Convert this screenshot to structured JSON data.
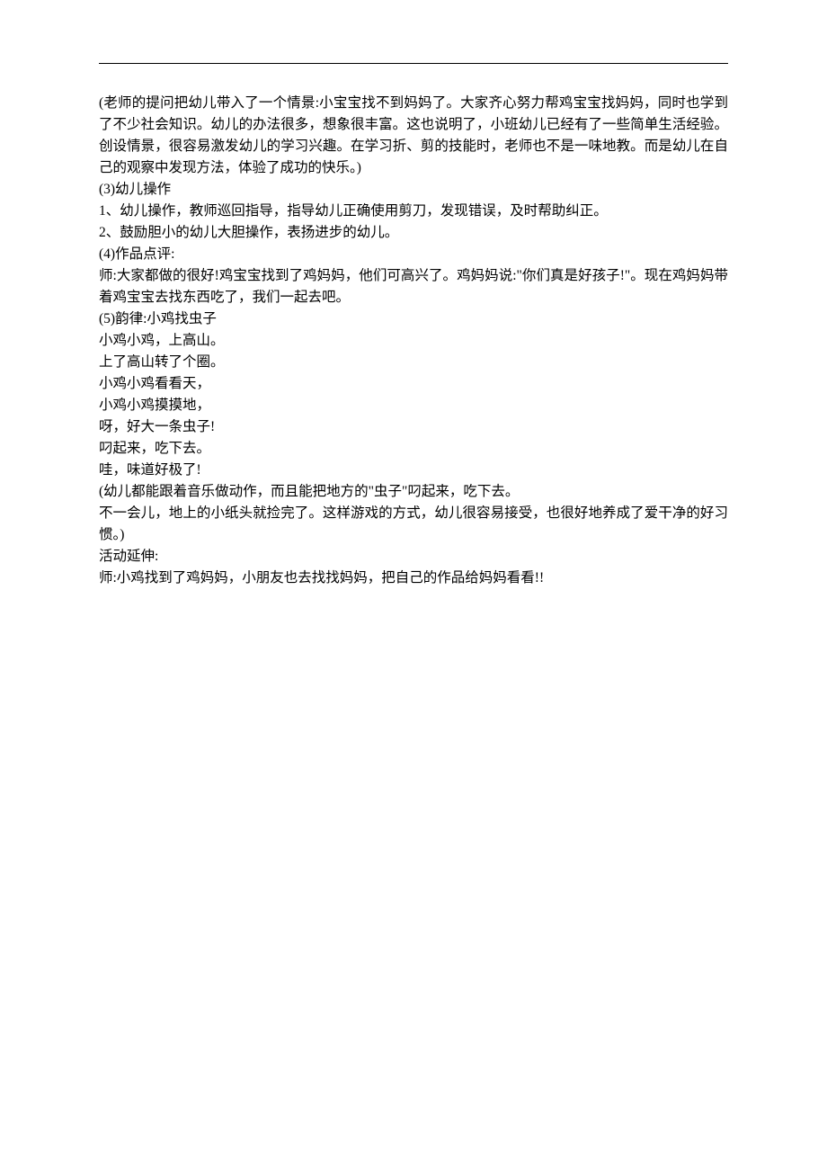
{
  "lines": [
    "(老师的提问把幼儿带入了一个情景:小宝宝找不到妈妈了。大家齐心努力帮鸡宝宝找妈妈，同时也学到了不少社会知识。幼儿的办法很多，想象很丰富。这也说明了，小班幼儿已经有了一些简单生活经验。创设情景，很容易激发幼儿的学习兴趣。在学习折、剪的技能时，老师也不是一味地教。而是幼儿在自己的观察中发现方法，体验了成功的快乐。)",
    "(3)幼儿操作",
    "1、幼儿操作，教师巡回指导，指导幼儿正确使用剪刀，发现错误，及时帮助纠正。",
    "2、鼓励胆小的幼儿大胆操作，表扬进步的幼儿。",
    "(4)作品点评:",
    "师:大家都做的很好!鸡宝宝找到了鸡妈妈，他们可高兴了。鸡妈妈说:\"你们真是好孩子!\"。现在鸡妈妈带着鸡宝宝去找东西吃了，我们一起去吧。",
    "(5)韵律:小鸡找虫子",
    "小鸡小鸡，上高山。",
    "上了高山转了个圈。",
    "小鸡小鸡看看天，",
    "小鸡小鸡摸摸地，",
    "呀，好大一条虫子!",
    "叼起来，吃下去。",
    "哇，味道好极了!",
    "(幼儿都能跟着音乐做动作，而且能把地方的\"虫子\"叼起来，吃下去。",
    "不一会儿，地上的小纸头就捡完了。这样游戏的方式，幼儿很容易接受，也很好地养成了爱干净的好习惯。)",
    "活动延伸:",
    "师:小鸡找到了鸡妈妈，小朋友也去找找妈妈，把自己的作品给妈妈看看!!"
  ]
}
